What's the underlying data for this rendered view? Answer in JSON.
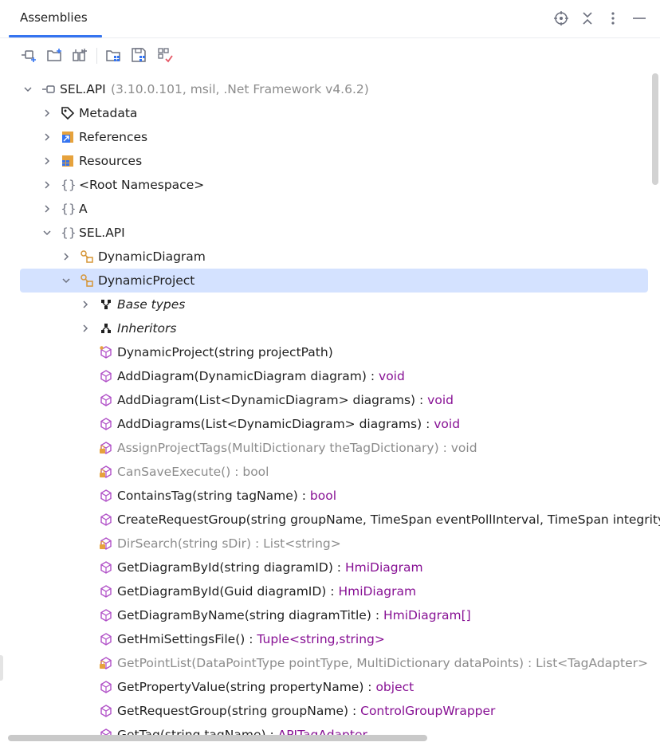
{
  "panel": {
    "title": "Assemblies",
    "header_icons": [
      "locate-icon",
      "collapse-icon",
      "more-options-icon",
      "minimize-icon"
    ]
  },
  "toolbar": {
    "icons": [
      "add-assembly-icon",
      "open-folder-icon",
      "open-from-nuget-icon",
      "assembly-list-icon",
      "save-icon",
      "clear-icon"
    ]
  },
  "colors": {
    "accent": "#3574f0",
    "selection": "#d4e2ff",
    "type": "#871094",
    "dim": "#8c8c8c"
  },
  "tree": {
    "root": {
      "name": "SEL.API",
      "meta": "(3.10.0.101, msil, .Net Framework v4.6.2)"
    },
    "items": {
      "metadata": "Metadata",
      "references": "References",
      "resources": "Resources",
      "root_namespace": "<Root Namespace>",
      "ns_a": "A",
      "ns_selapi": "SEL.API",
      "dynamic_diagram": "DynamicDiagram",
      "dynamic_project": "DynamicProject",
      "base_types": "Base types",
      "inheritors": "Inheritors"
    },
    "members": [
      {
        "sig": "DynamicProject(string projectPath)",
        "ret": "",
        "kind": "ctor"
      },
      {
        "sig": "AddDiagram(DynamicDiagram diagram)",
        "ret": "void",
        "kind": "public"
      },
      {
        "sig": "AddDiagram(List<DynamicDiagram> diagrams)",
        "ret": "void",
        "kind": "public"
      },
      {
        "sig": "AddDiagrams(List<DynamicDiagram> diagrams)",
        "ret": "void",
        "kind": "public"
      },
      {
        "sig": "AssignProjectTags(MultiDictionary theTagDictionary)",
        "ret": "void",
        "kind": "private"
      },
      {
        "sig": "CanSaveExecute()",
        "ret": "bool",
        "kind": "private"
      },
      {
        "sig": "ContainsTag(string tagName)",
        "ret": "bool",
        "kind": "public"
      },
      {
        "sig": "CreateRequestGroup(string groupName, TimeSpan eventPollInterval, TimeSpan integrityP",
        "ret": "",
        "kind": "public"
      },
      {
        "sig": "DirSearch(string sDir)",
        "ret": "List<string>",
        "kind": "private"
      },
      {
        "sig": "GetDiagramById(string diagramID)",
        "ret": "HmiDiagram",
        "kind": "public"
      },
      {
        "sig": "GetDiagramById(Guid diagramID)",
        "ret": "HmiDiagram",
        "kind": "public"
      },
      {
        "sig": "GetDiagramByName(string diagramTitle)",
        "ret": "HmiDiagram[]",
        "kind": "public"
      },
      {
        "sig": "GetHmiSettingsFile()",
        "ret": "Tuple<string,string>",
        "kind": "public"
      },
      {
        "sig": "GetPointList(DataPointType pointType, MultiDictionary dataPoints)",
        "ret": "List<TagAdapter>",
        "kind": "private"
      },
      {
        "sig": "GetPropertyValue(string propertyName)",
        "ret": "object",
        "kind": "public"
      },
      {
        "sig": "GetRequestGroup(string groupName)",
        "ret": "ControlGroupWrapper",
        "kind": "public"
      },
      {
        "sig": "GetTag(string tagName)",
        "ret": "APITagAdapter",
        "kind": "public"
      }
    ]
  }
}
